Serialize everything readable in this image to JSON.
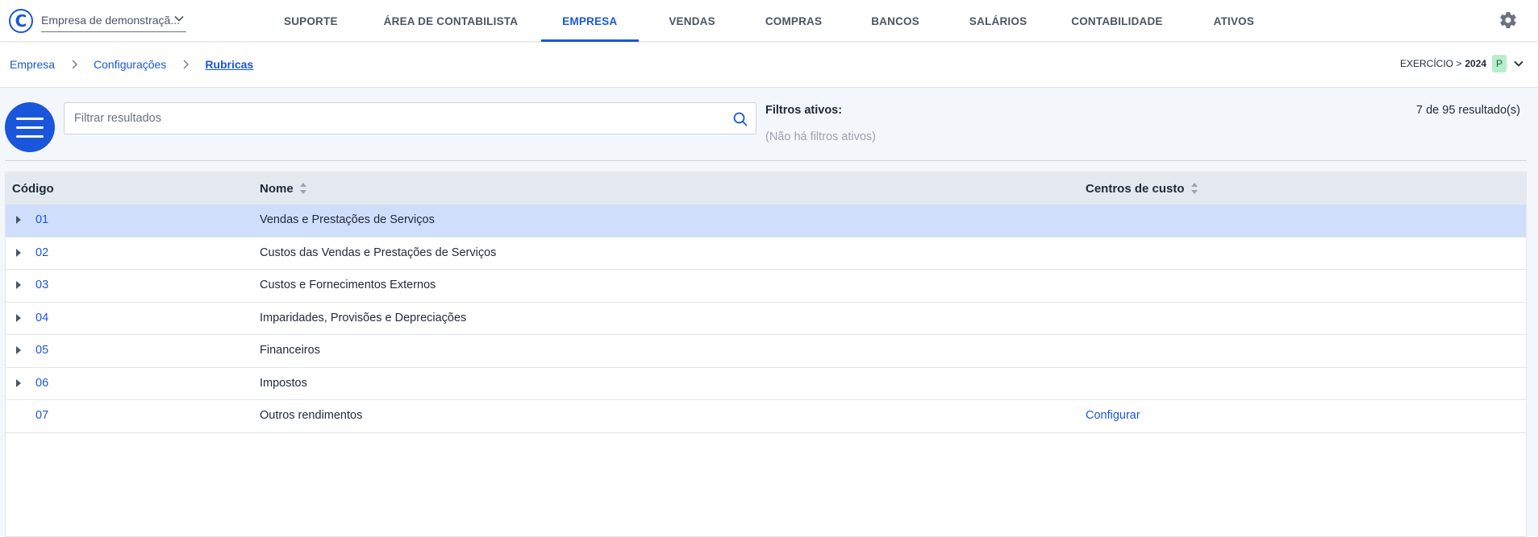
{
  "app": {
    "company_select": "Empresa de demonstraçã...",
    "logo_letter": "C"
  },
  "nav": {
    "items": [
      {
        "label": "SUPORTE"
      },
      {
        "label": "ÁREA DE CONTABILISTA"
      },
      {
        "label": "EMPRESA"
      },
      {
        "label": "VENDAS"
      },
      {
        "label": "COMPRAS"
      },
      {
        "label": "BANCOS"
      },
      {
        "label": "SALÁRIOS"
      },
      {
        "label": "CONTABILIDADE"
      },
      {
        "label": "ATIVOS"
      }
    ],
    "active_index": 2
  },
  "breadcrumb": {
    "items": [
      {
        "label": "Empresa"
      },
      {
        "label": "Configurações"
      },
      {
        "label": "Rubricas"
      }
    ]
  },
  "exercise": {
    "label": "EXERCÍCIO >",
    "year": "2024",
    "badge": "P"
  },
  "search": {
    "placeholder": "Filtrar resultados"
  },
  "filters": {
    "title": "Filtros ativos:",
    "empty": "(Não há filtros ativos)"
  },
  "results": {
    "text": "7 de 95 resultado(s)"
  },
  "table": {
    "headers": {
      "code": "Código",
      "name": "Nome",
      "cost_centers": "Centros de custo"
    },
    "rows": [
      {
        "code": "01",
        "name": "Vendas e Prestações de Serviços",
        "cost_centers": ""
      },
      {
        "code": "02",
        "name": "Custos das Vendas e Prestações de Serviços",
        "cost_centers": ""
      },
      {
        "code": "03",
        "name": "Custos e Fornecimentos Externos",
        "cost_centers": ""
      },
      {
        "code": "04",
        "name": "Imparidades, Provisões e Depreciações",
        "cost_centers": ""
      },
      {
        "code": "05",
        "name": "Financeiros",
        "cost_centers": ""
      },
      {
        "code": "06",
        "name": "Impostos",
        "cost_centers": ""
      },
      {
        "code": "07",
        "name": "Outros rendimentos",
        "cost_centers": "Configurar"
      }
    ]
  },
  "colors": {
    "accent": "#1a56db",
    "selected_row": "#cfdefb",
    "panel_bg": "#f3f7fc",
    "badge_bg": "#b9eecb"
  },
  "icons": {
    "menu": "hamburger-icon",
    "search": "search-icon",
    "settings": "gear-icon",
    "expand": "caret-right-icon",
    "sort": "sort-icon"
  }
}
